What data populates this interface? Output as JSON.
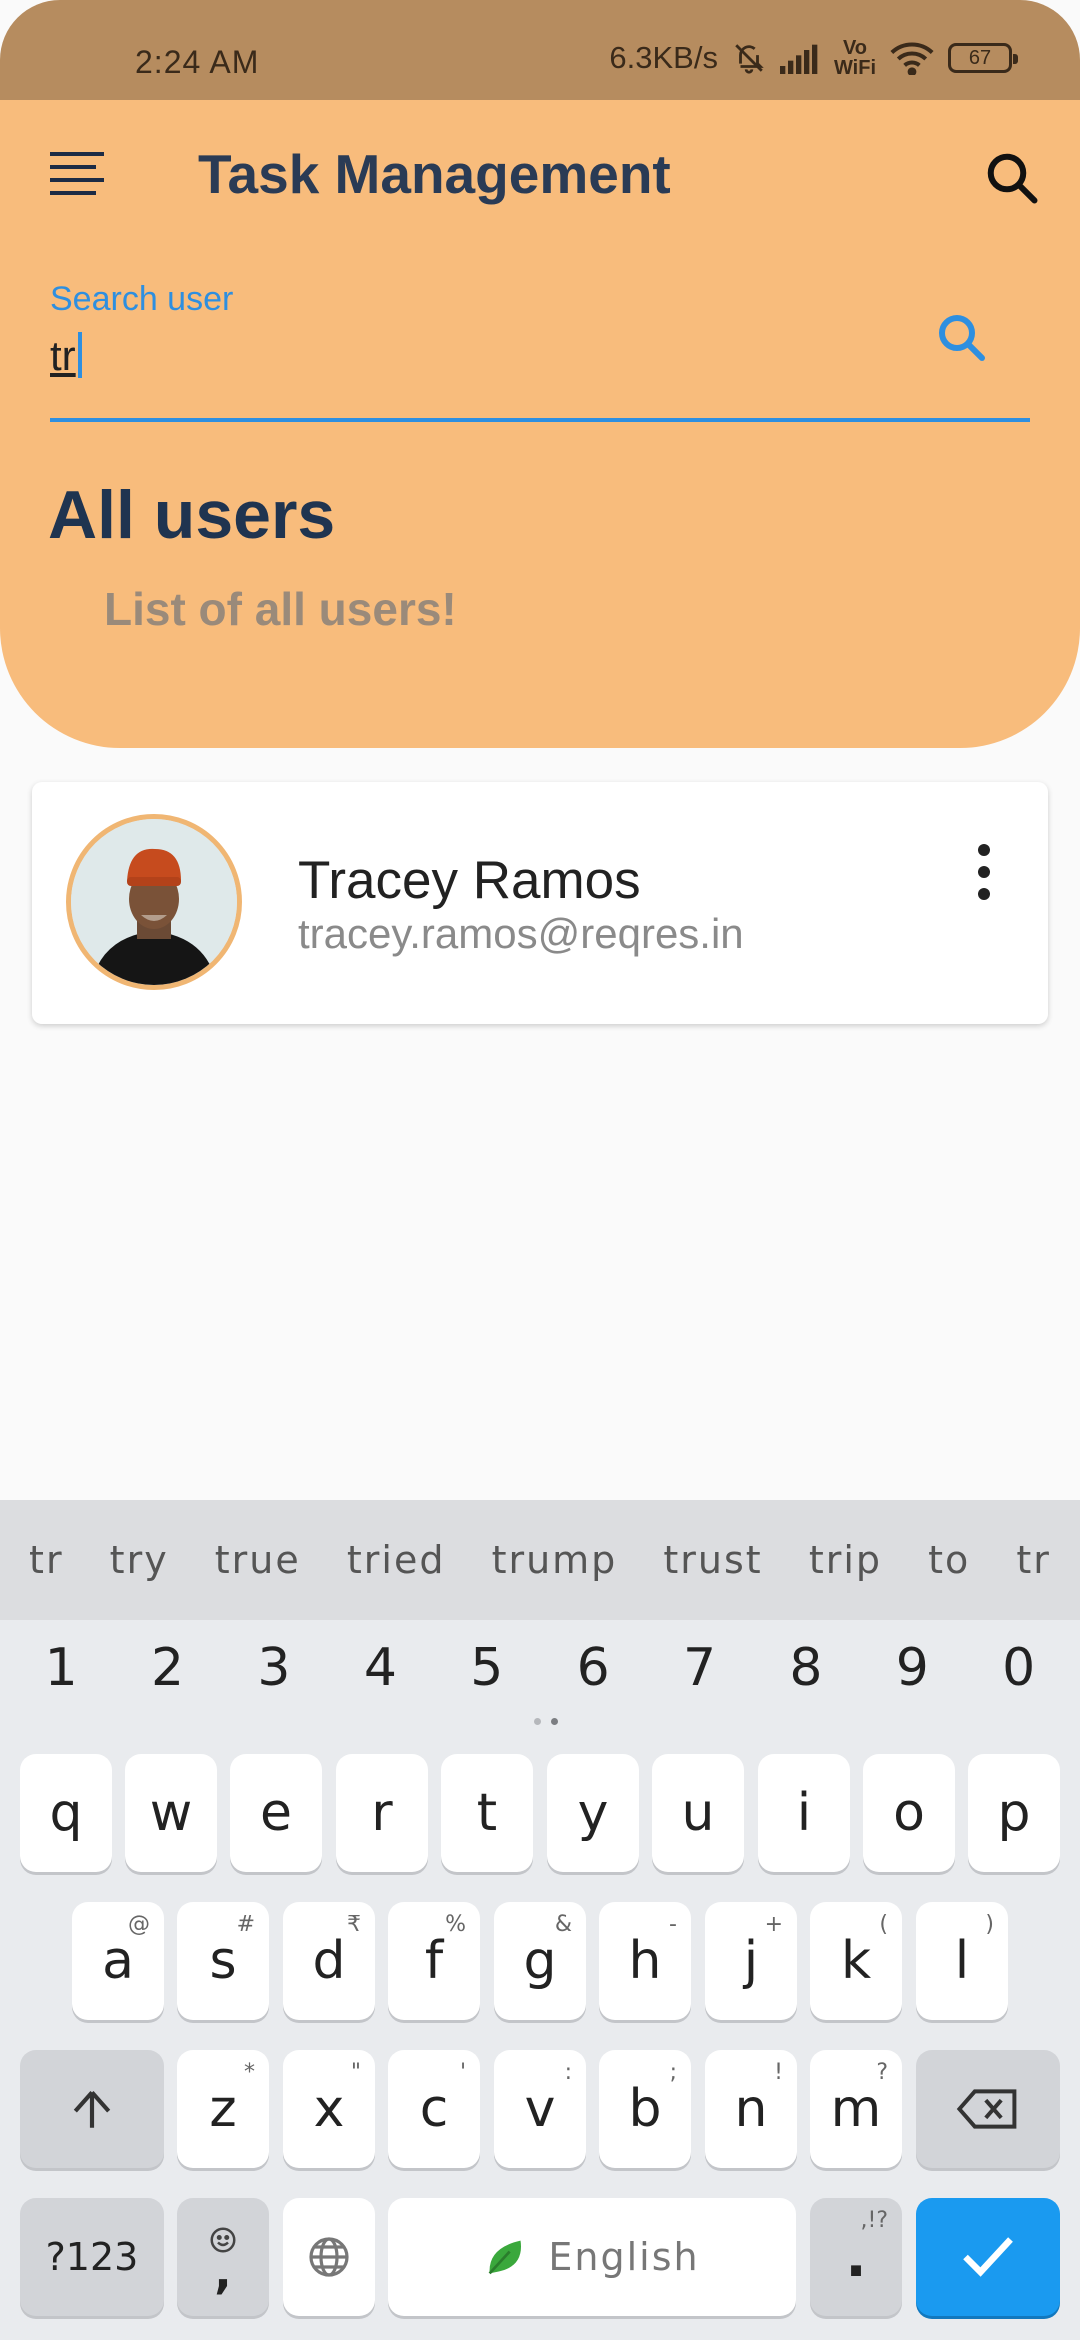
{
  "status": {
    "time": "2:24 AM",
    "net_speed": "6.3KB/s",
    "vowifi": "Vo\nWiFi",
    "battery": "67"
  },
  "app": {
    "title": "Task Management"
  },
  "search": {
    "label": "Search user",
    "value": "tr"
  },
  "section": {
    "title": "All users",
    "subtitle": "List of all users!"
  },
  "users": [
    {
      "name": "Tracey Ramos",
      "email": "tracey.ramos@reqres.in"
    }
  ],
  "keyboard": {
    "suggestions": [
      "tr",
      "try",
      "true",
      "tried",
      "trump",
      "trust",
      "trip",
      "to",
      "tr"
    ],
    "numbers": [
      "1",
      "2",
      "3",
      "4",
      "5",
      "6",
      "7",
      "8",
      "9",
      "0"
    ],
    "row1": [
      "q",
      "w",
      "e",
      "r",
      "t",
      "y",
      "u",
      "i",
      "o",
      "p"
    ],
    "row2": [
      {
        "k": "a",
        "h": "@"
      },
      {
        "k": "s",
        "h": "#"
      },
      {
        "k": "d",
        "h": "₹"
      },
      {
        "k": "f",
        "h": "%"
      },
      {
        "k": "g",
        "h": "&"
      },
      {
        "k": "h",
        "h": "-"
      },
      {
        "k": "j",
        "h": "+"
      },
      {
        "k": "k",
        "h": "("
      },
      {
        "k": "l",
        "h": ")"
      }
    ],
    "row3": [
      {
        "k": "z",
        "h": "*"
      },
      {
        "k": "x",
        "h": "\""
      },
      {
        "k": "c",
        "h": "'"
      },
      {
        "k": "v",
        "h": ":"
      },
      {
        "k": "b",
        "h": ";"
      },
      {
        "k": "n",
        "h": "!"
      },
      {
        "k": "m",
        "h": "?"
      }
    ],
    "symbols_label": "?123",
    "comma": ",",
    "space_label": "English",
    "period": ".",
    "period_hint": ",!?"
  },
  "colors": {
    "header": "#f8bc7c",
    "status_bar": "#b68c5f",
    "accent": "#2e8fe0",
    "title_text": "#1f3450"
  }
}
